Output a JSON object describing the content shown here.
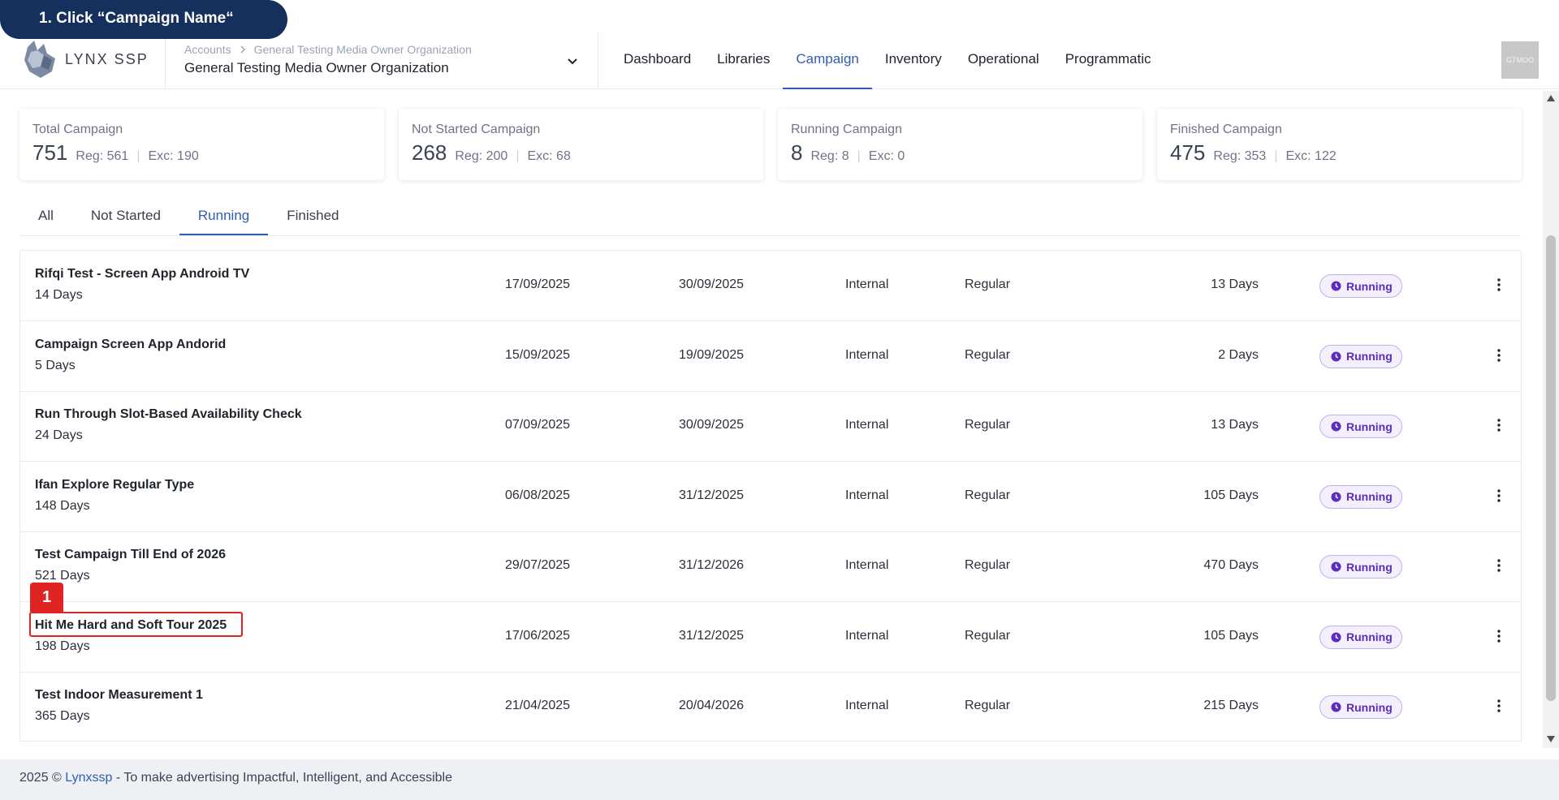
{
  "banner": {
    "text": "1. Click “Campaign Name“"
  },
  "logo": {
    "text": "LYNX SSP"
  },
  "breadcrumb": {
    "root": "Accounts",
    "current": "General Testing Media Owner Organization"
  },
  "organization": {
    "name": "General Testing Media Owner Organization"
  },
  "nav": {
    "items": [
      {
        "label": "Dashboard"
      },
      {
        "label": "Libraries"
      },
      {
        "label": "Campaign",
        "active": true
      },
      {
        "label": "Inventory"
      },
      {
        "label": "Operational"
      },
      {
        "label": "Programmatic"
      }
    ]
  },
  "user": {
    "initials": "GTMOO"
  },
  "stats": [
    {
      "title": "Total Campaign",
      "total": "751",
      "reg": "Reg: 561",
      "exc": "Exc: 190"
    },
    {
      "title": "Not Started Campaign",
      "total": "268",
      "reg": "Reg: 200",
      "exc": "Exc: 68"
    },
    {
      "title": "Running Campaign",
      "total": "8",
      "reg": "Reg: 8",
      "exc": "Exc: 0"
    },
    {
      "title": "Finished Campaign",
      "total": "475",
      "reg": "Reg: 353",
      "exc": "Exc: 122"
    }
  ],
  "tabs": [
    {
      "label": "All"
    },
    {
      "label": "Not Started"
    },
    {
      "label": "Running",
      "active": true
    },
    {
      "label": "Finished"
    }
  ],
  "campaigns": [
    {
      "name": "Rifqi Test - Screen App Android TV",
      "duration": "14 Days",
      "start": "17/09/2025",
      "end": "30/09/2025",
      "type": "Internal",
      "kind": "Regular",
      "remaining": "13 Days",
      "status": "Running"
    },
    {
      "name": "Campaign Screen App Andorid",
      "duration": "5 Days",
      "start": "15/09/2025",
      "end": "19/09/2025",
      "type": "Internal",
      "kind": "Regular",
      "remaining": "2 Days",
      "status": "Running"
    },
    {
      "name": "Run Through Slot-Based Availability Check",
      "duration": "24 Days",
      "start": "07/09/2025",
      "end": "30/09/2025",
      "type": "Internal",
      "kind": "Regular",
      "remaining": "13 Days",
      "status": "Running"
    },
    {
      "name": "Ifan Explore Regular Type",
      "duration": "148 Days",
      "start": "06/08/2025",
      "end": "31/12/2025",
      "type": "Internal",
      "kind": "Regular",
      "remaining": "105 Days",
      "status": "Running"
    },
    {
      "name": "Test Campaign Till End of 2026",
      "duration": "521 Days",
      "start": "29/07/2025",
      "end": "31/12/2026",
      "type": "Internal",
      "kind": "Regular",
      "remaining": "470 Days",
      "status": "Running"
    },
    {
      "name": "Hit Me Hard and Soft Tour 2025",
      "duration": "198 Days",
      "start": "17/06/2025",
      "end": "31/12/2025",
      "type": "Internal",
      "kind": "Regular",
      "remaining": "105 Days",
      "status": "Running"
    },
    {
      "name": "Test Indoor Measurement 1",
      "duration": "365 Days",
      "start": "21/04/2025",
      "end": "20/04/2026",
      "type": "Internal",
      "kind": "Regular",
      "remaining": "215 Days",
      "status": "Running"
    }
  ],
  "step_marker": {
    "label": "1"
  },
  "footer": {
    "year": "2025 © ",
    "brand": "Lynxssp",
    "tagline": " - To make advertising Impactful, Intelligent, and Accessible"
  },
  "colors": {
    "primary": "#2f5db6",
    "banner": "#15305c",
    "running": "#5a2dbd",
    "highlight": "#e02424"
  }
}
